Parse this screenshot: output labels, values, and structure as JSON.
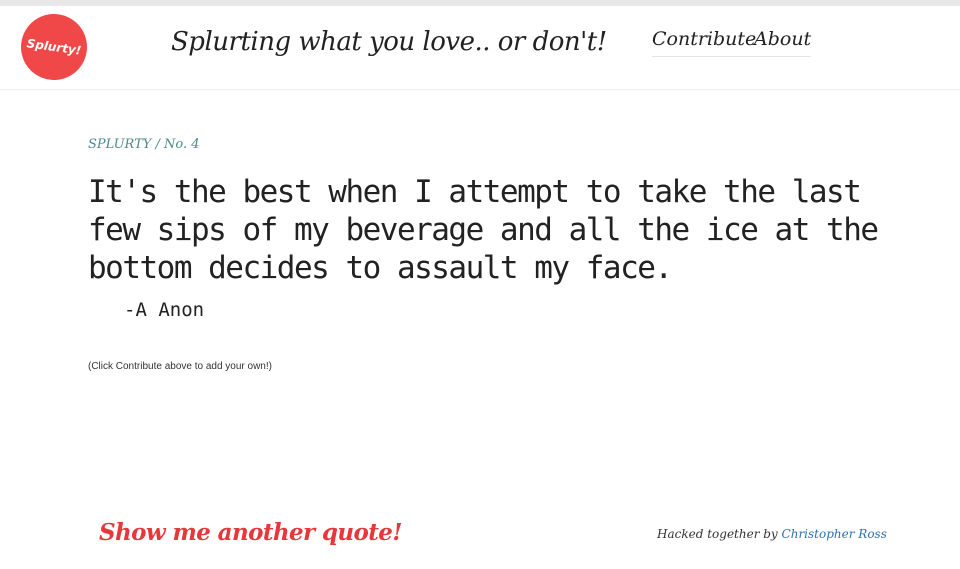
{
  "header": {
    "logo_text": "Splurty!",
    "tagline": "Splurting what you love.. or don't!",
    "nav": {
      "contribute": "Contribute",
      "about": "About"
    }
  },
  "main": {
    "breadcrumb": "SPLURTY / No. 4",
    "quote": "It's the best when I attempt to take the last few sips of my beverage and all the ice at the bottom decides to assault my face.",
    "author": "-A Anon",
    "hint": "(Click Contribute above to add your own!)"
  },
  "footer": {
    "another_quote": "Show me another quote!",
    "credits_prefix": "Hacked together by",
    "credits_name": "Christopher Ross"
  },
  "colors": {
    "logo_red": "#f04848",
    "link_red": "#e8373a",
    "breadcrumb_teal": "#4a8a8a",
    "credit_link_blue": "#2f6fb0"
  }
}
